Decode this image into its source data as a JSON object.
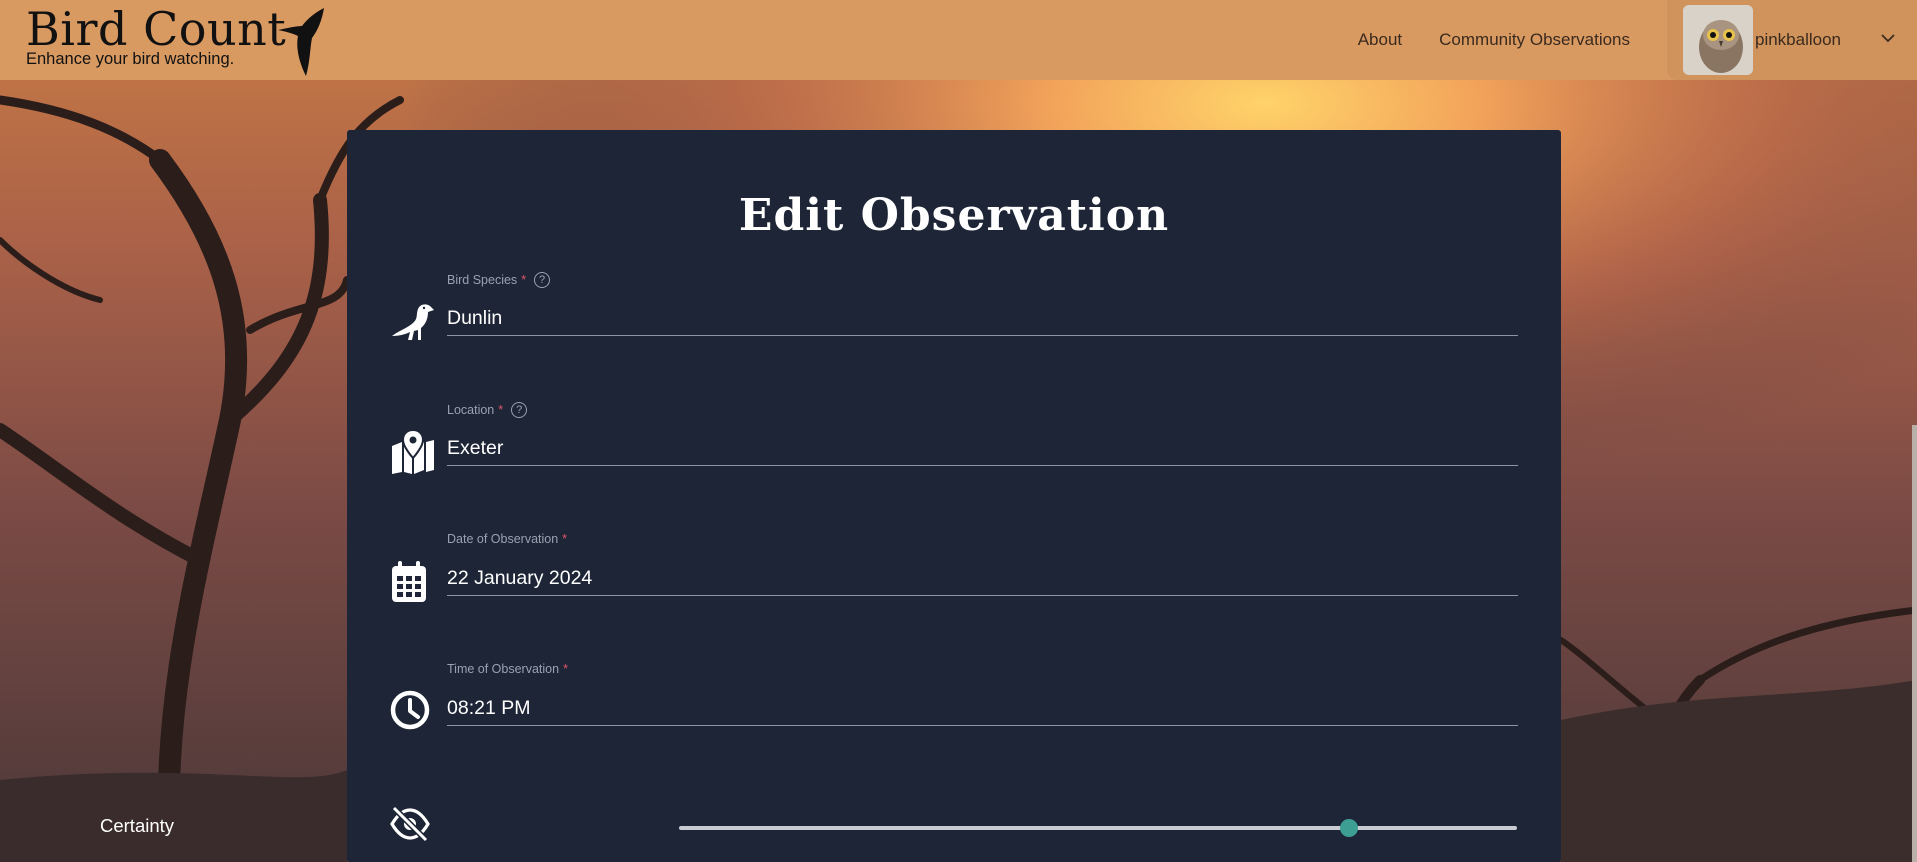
{
  "brand": {
    "title": "Bird Count",
    "tagline": "Enhance your bird watching."
  },
  "nav": {
    "about": "About",
    "community": "Community Observations",
    "username": "pinkballoon"
  },
  "form": {
    "title": "Edit Observation",
    "species": {
      "label": "Bird Species",
      "required": "*",
      "value": "Dunlin"
    },
    "location": {
      "label": "Location",
      "required": "*",
      "value": "Exeter"
    },
    "date": {
      "label": "Date of Observation",
      "required": "*",
      "value": "22 January 2024"
    },
    "time": {
      "label": "Time of Observation",
      "required": "*",
      "value": "08:21 PM"
    },
    "certainty": {
      "label": "Certainty",
      "value_fraction": 0.8
    }
  },
  "icons": {
    "help": "help-circle-icon",
    "species": "bird-icon",
    "location": "map-location-icon",
    "date": "calendar-icon",
    "time": "clock-icon",
    "certainty": "eye-slash-icon",
    "user_menu": "chevron-down-icon"
  },
  "colors": {
    "header": "#d99a62",
    "card": "#1d2536",
    "slider_thumb": "#3d9f93",
    "required": "#e0556a"
  }
}
